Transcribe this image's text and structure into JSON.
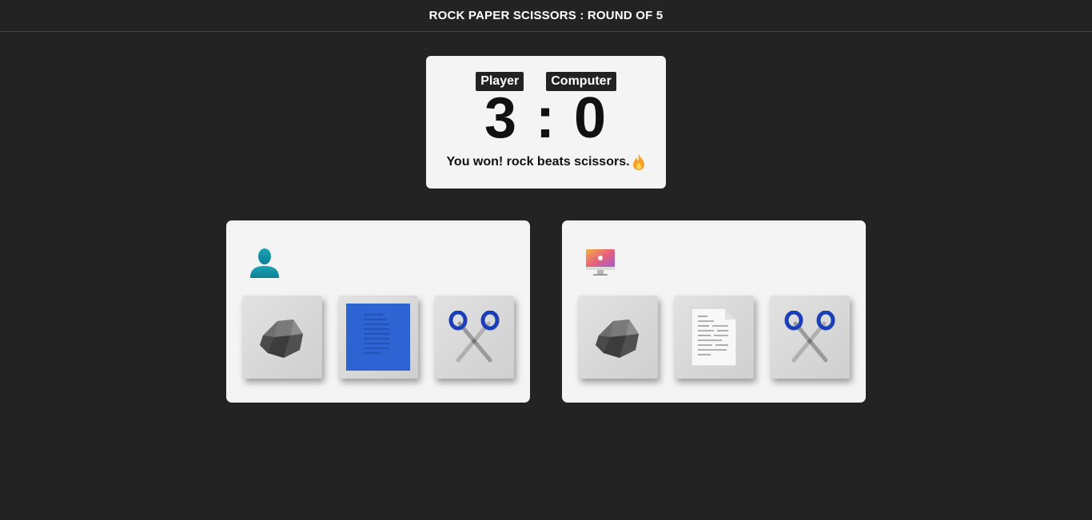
{
  "header": {
    "title": "ROCK PAPER SCISSORS : ROUND OF 5"
  },
  "scoreboard": {
    "player_label": "Player",
    "computer_label": "Computer",
    "player_score": "3",
    "separator": ":",
    "computer_score": "0",
    "message": "You won! rock beats scissors.",
    "message_icon": "fire-icon"
  },
  "player_panel": {
    "icon": "user-icon",
    "choices": [
      {
        "name": "rock",
        "icon": "rock-icon"
      },
      {
        "name": "paper",
        "icon": "paper-blue-icon"
      },
      {
        "name": "scissors",
        "icon": "scissors-icon"
      }
    ]
  },
  "computer_panel": {
    "icon": "desktop-computer-icon",
    "choices": [
      {
        "name": "rock",
        "icon": "rock-icon"
      },
      {
        "name": "paper",
        "icon": "paper-document-icon"
      },
      {
        "name": "scissors",
        "icon": "scissors-icon"
      }
    ]
  },
  "colors": {
    "background": "#232323",
    "card": "#f4f4f4",
    "accent_blue": "#2e63d4",
    "scissors_blue": "#1c3fb8"
  }
}
